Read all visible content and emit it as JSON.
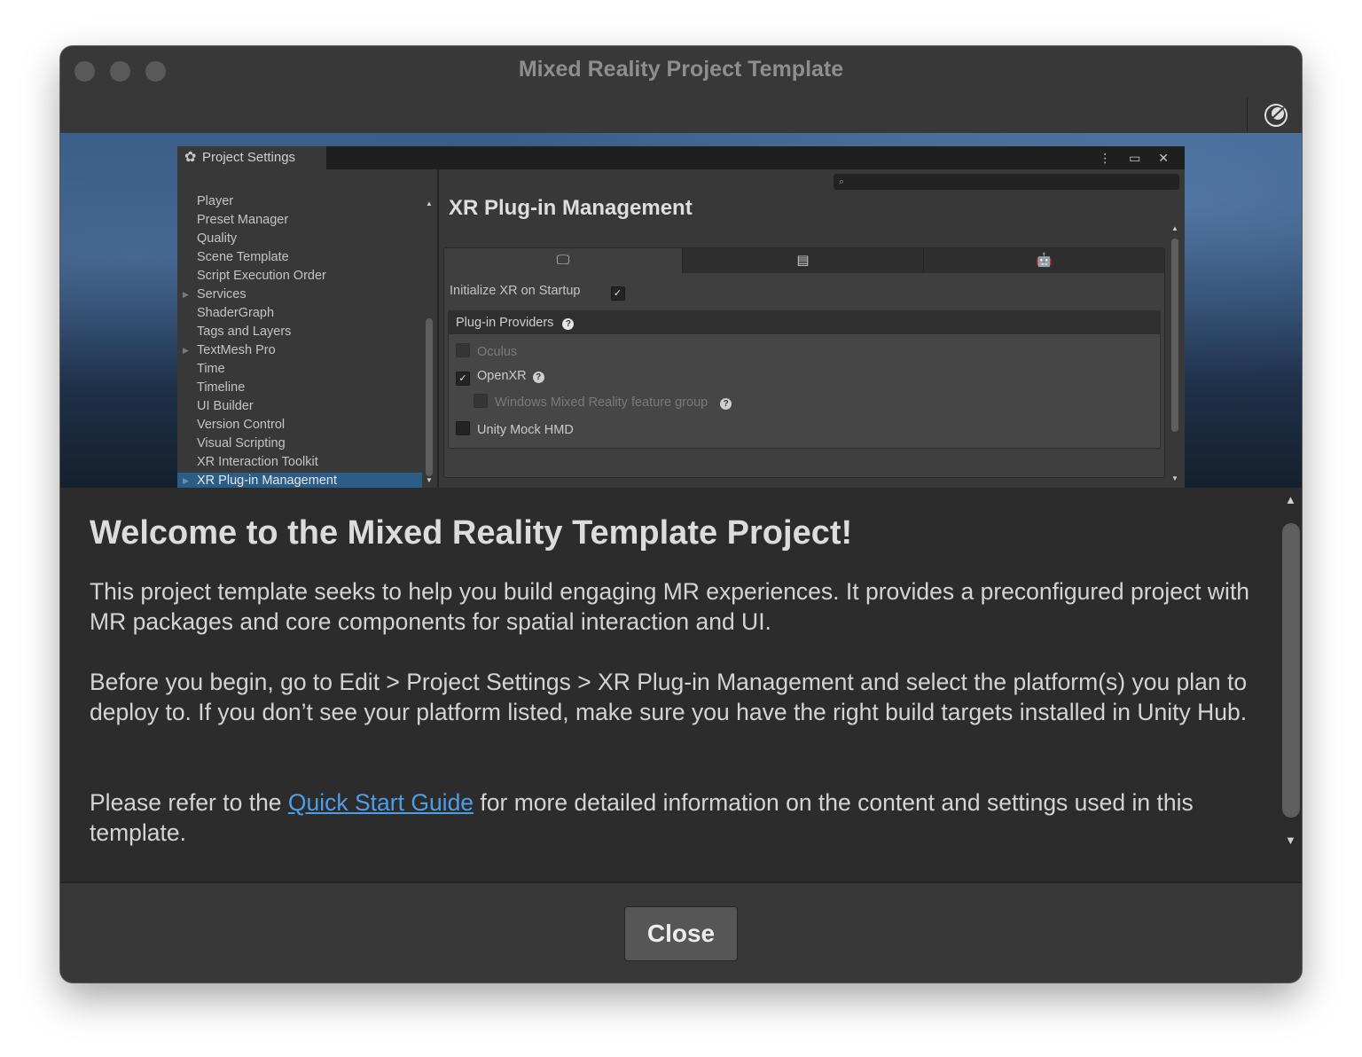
{
  "window": {
    "title": "Mixed Reality Project Template"
  },
  "project_settings": {
    "tab_label": "Project Settings",
    "settings_glyph": "✿",
    "window_controls": "⋮ ▭ ✕",
    "search_glyph": "⌕",
    "nav_items": [
      "Player",
      "Preset Manager",
      "Quality",
      "Scene Template",
      "Script Execution Order",
      "Services",
      "ShaderGraph",
      "Tags and Layers",
      "TextMesh Pro",
      "Time",
      "Timeline",
      "UI Builder",
      "Version Control",
      "Visual Scripting",
      "XR Interaction Toolkit",
      "XR Plug-in Management"
    ],
    "expandable_glyph": "▶",
    "heading": "XR Plug-in Management",
    "platform_tabs": [
      "🖵",
      "▤",
      "🤖"
    ],
    "initialize_label": "Initialize XR on Startup",
    "check": "✓",
    "providers_label": "Plug-in Providers",
    "help": "?",
    "providers": {
      "oculus": "Oculus",
      "openxr": "OpenXR",
      "windows_mr": "Windows Mixed Reality feature group",
      "mock": "Unity Mock HMD"
    },
    "scroll_up": "▲",
    "scroll_down": "▼"
  },
  "content": {
    "heading": "Welcome to the Mixed Reality Template Project!",
    "para1": "This project template seeks to help you build engaging MR experiences. It provides a preconfigured project with MR packages and core components for spatial interaction and UI.",
    "para2": "Before you begin, go to Edit > Project Settings > XR Plug-in Management and select the platform(s) you plan to deploy to. If you don’t see your platform listed, make sure you have the right build targets installed in Unity Hub.",
    "para3_before": "Please refer to the ",
    "para3_link": "Quick Start Guide",
    "para3_after": " for more detailed information on the content and settings used in this template.",
    "scroll_up": "▲",
    "scroll_down": "▼"
  },
  "footer": {
    "close_label": "Close"
  }
}
